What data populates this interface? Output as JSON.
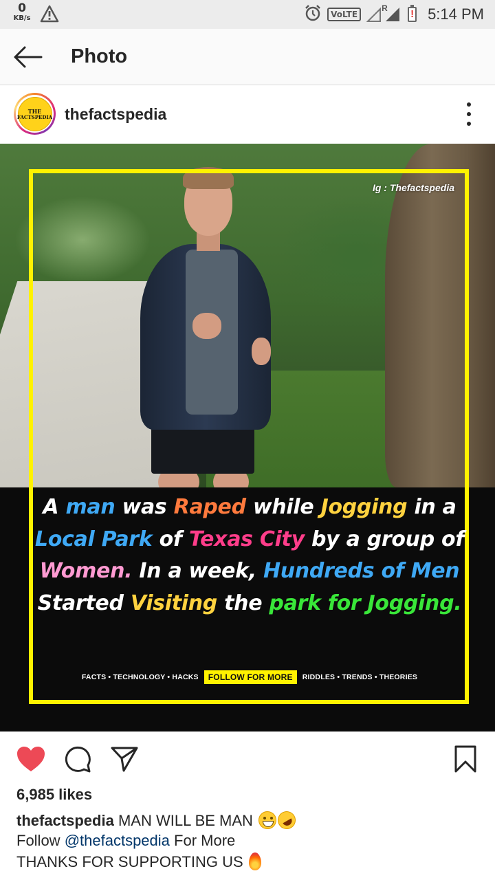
{
  "status_bar": {
    "net_speed_value": "0",
    "net_speed_unit": "KB/s",
    "volte": "VoLTE",
    "roaming": "R",
    "battery_alert": "!",
    "time": "5:14 PM"
  },
  "header": {
    "title": "Photo"
  },
  "post": {
    "username": "thefactspedia",
    "avatar_text_1": "THE",
    "avatar_text_2": "FACTSPEDIA",
    "image": {
      "watermark": "Ig : Thefactspedia",
      "fact_segments": [
        {
          "text": "A ",
          "color": "white"
        },
        {
          "text": "man",
          "color": "blue"
        },
        {
          "text": " was ",
          "color": "white"
        },
        {
          "text": "Raped",
          "color": "orange"
        },
        {
          "text": " while ",
          "color": "white"
        },
        {
          "text": "Jogging",
          "color": "yellow"
        },
        {
          "text": " in a ",
          "color": "white"
        },
        {
          "text": "Local Park",
          "color": "blue"
        },
        {
          "text": " of ",
          "color": "white"
        },
        {
          "text": "Texas City",
          "color": "pink"
        },
        {
          "text": " by a group of ",
          "color": "white"
        },
        {
          "text": "Women.",
          "color": "lpink"
        },
        {
          "text": " In a week, ",
          "color": "white"
        },
        {
          "text": "Hundreds of Men",
          "color": "blue"
        },
        {
          "text": " Started ",
          "color": "white"
        },
        {
          "text": "Visiting",
          "color": "yellow"
        },
        {
          "text": " the ",
          "color": "white"
        },
        {
          "text": "park for Jogging.",
          "color": "green"
        }
      ],
      "tagline_left": "FACTS • TECHNOLOGY • HACKS",
      "follow_badge": "FOLLOW FOR MORE",
      "tagline_right": "RIDDLES • TRENDS • THEORIES"
    },
    "likes": "6,985 likes",
    "caption": {
      "username": "thefactspedia",
      "text": "MAN WILL BE MAN",
      "line2_prefix": "Follow ",
      "line2_mention": "@thefactspedia",
      "line2_suffix": " For More",
      "line3": "THANKS FOR SUPPORTING US"
    }
  },
  "colors": {
    "like_red": "#ed4956",
    "frame_yellow": "#fff200",
    "mention_blue": "#003569"
  },
  "icons": [
    "back-arrow-icon",
    "more-options-icon",
    "heart-icon",
    "comment-icon",
    "share-icon",
    "bookmark-icon",
    "alarm-icon",
    "warning-icon",
    "signal-icon",
    "battery-icon"
  ]
}
